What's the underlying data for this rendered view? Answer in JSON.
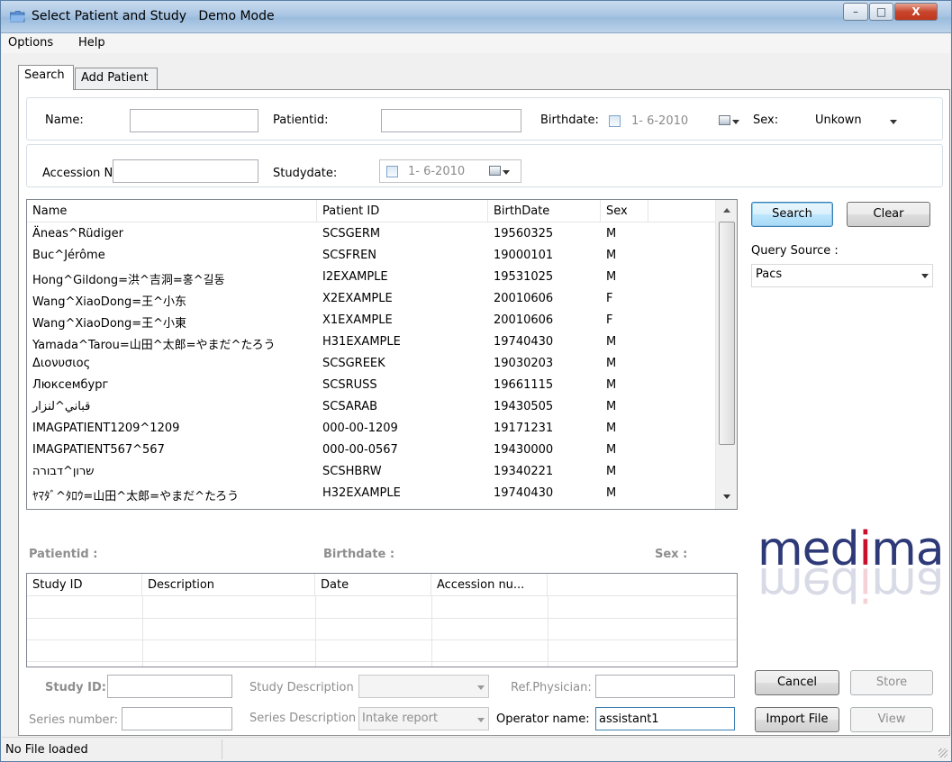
{
  "window": {
    "title": "Select Patient and Study",
    "mode": "Demo Mode",
    "minimize": "–",
    "maximize": "□",
    "close": "X"
  },
  "menu": [
    "Options",
    "Help"
  ],
  "tabs": [
    "Search",
    "Add Patient"
  ],
  "search": {
    "name_label": "Name:",
    "name_value": "",
    "patientid_label": "Patientid:",
    "patientid_value": "",
    "birthdate_label": "Birthdate:",
    "birthdate_value": "1- 6-2010",
    "sex_label": "Sex:",
    "sex_value": "Unkown",
    "accession_label": "Accession Nr.:",
    "accession_value": "",
    "studydate_label": "Studydate:",
    "studydate_value": "1- 6-2010"
  },
  "patients": {
    "columns": [
      "Name",
      "Patient ID",
      "BirthDate",
      "Sex"
    ],
    "rows": [
      [
        "Äneas^Rüdiger",
        "SCSGERM",
        "19560325",
        "M"
      ],
      [
        "Buc^Jérôme",
        "SCSFREN",
        "19000101",
        "M"
      ],
      [
        "Hong^Gildong=洪^吉洞=홍^길동",
        "I2EXAMPLE",
        "19531025",
        "M"
      ],
      [
        "Wang^XiaoDong=王^小东",
        "X2EXAMPLE",
        "20010606",
        "F"
      ],
      [
        "Wang^XiaoDong=王^小東",
        "X1EXAMPLE",
        "20010606",
        "F"
      ],
      [
        "Yamada^Tarou=山田^太郎=やまだ^たろう",
        "H31EXAMPLE",
        "19740430",
        "M"
      ],
      [
        "Διονυσιος",
        "SCSGREEK",
        "19030203",
        "M"
      ],
      [
        "Люксембург",
        "SCSRUSS",
        "19661115",
        "M"
      ],
      [
        "قباني^لنزار",
        "SCSARAB",
        "19430505",
        "M"
      ],
      [
        "IMAGPATIENT1209^1209",
        "000-00-1209",
        "19171231",
        "M"
      ],
      [
        "IMAGPATIENT567^567",
        "000-00-0567",
        "19430000",
        "M"
      ],
      [
        "שרון^דבורה",
        "SCSHBRW",
        "19340221",
        "M"
      ],
      [
        "ﾔﾏﾀﾞ^ﾀﾛｳ=山田^太郎=やまだ^たろう",
        "H32EXAMPLE",
        "19740430",
        "M"
      ]
    ]
  },
  "actions": {
    "search": "Search",
    "clear": "Clear",
    "query_source_label": "Query Source :",
    "query_source_value": "Pacs"
  },
  "detail": {
    "patientid_label": "Patientid :",
    "birthdate_label": "Birthdate :",
    "sex_label": "Sex :"
  },
  "studies": {
    "columns": [
      "Study ID",
      "Description",
      "Date",
      "Accession nu..."
    ]
  },
  "form": {
    "study_id_label": "Study ID:",
    "study_id_value": "",
    "study_desc_label": "Study Description",
    "study_desc_value": "",
    "ref_physician_label": "Ref.Physician:",
    "ref_physician_value": "",
    "series_number_label": "Series number:",
    "series_number_value": "",
    "series_desc_label": "Series Description",
    "series_desc_value": "Intake report",
    "operator_label": "Operator name:",
    "operator_value": "assistant1"
  },
  "buttons": {
    "cancel": "Cancel",
    "store": "Store",
    "import_file": "Import File",
    "view": "View"
  },
  "logo": {
    "text_plain_start": "med",
    "text_accent": "i",
    "text_plain_end": "ma",
    "accent_color": "#c8102e",
    "main_color": "#2e3a78"
  },
  "status": {
    "text": "No File loaded"
  }
}
